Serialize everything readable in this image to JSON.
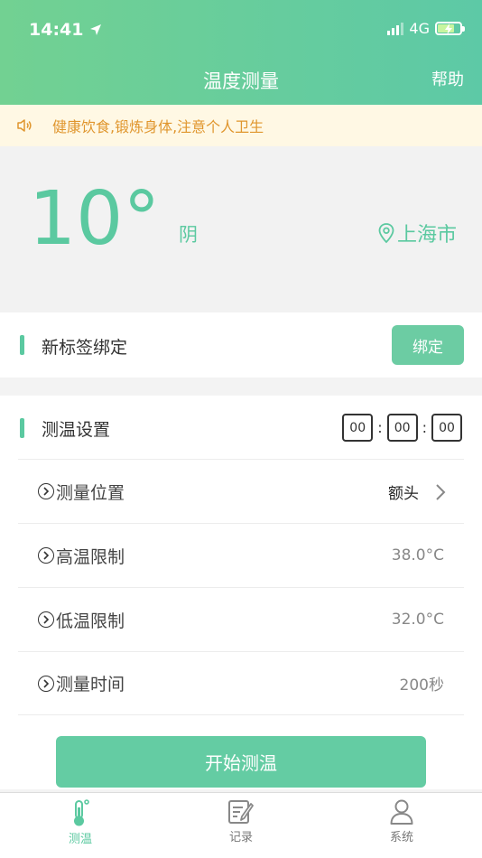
{
  "status_bar": {
    "time": "14:41",
    "network": "4G"
  },
  "header": {
    "title": "温度测量",
    "help_label": "帮助"
  },
  "notice": {
    "text": "健康饮食,锻炼身体,注意个人卫生"
  },
  "weather": {
    "temperature": "10°",
    "condition": "阴",
    "city": "上海市"
  },
  "bind": {
    "title": "新标签绑定",
    "button_label": "绑定"
  },
  "settings": {
    "title": "测温设置",
    "timer": {
      "h": "00",
      "m": "00",
      "s": "00",
      "separator": ":"
    },
    "rows": [
      {
        "label": "测量位置",
        "value": "额头"
      },
      {
        "label": "高温限制",
        "value": "38.0°C"
      },
      {
        "label": "低温限制",
        "value": "32.0°C"
      },
      {
        "label": "测量时间",
        "value": "200秒"
      }
    ]
  },
  "start_button": {
    "label": "开始测温"
  },
  "tabs": [
    {
      "label": "测温",
      "icon": "thermometer-icon",
      "active": true
    },
    {
      "label": "记录",
      "icon": "record-icon",
      "active": false
    },
    {
      "label": "系统",
      "icon": "user-icon",
      "active": false
    }
  ],
  "colors": {
    "accent": "#5bc9a0",
    "notice_text": "#e0962e",
    "notice_bg": "#fff8e4"
  }
}
